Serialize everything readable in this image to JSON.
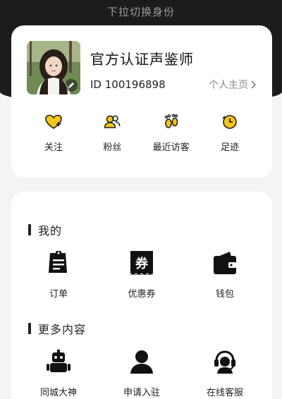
{
  "header": {
    "pull_hint": "下拉切换身份"
  },
  "profile": {
    "name": "官方认证声鉴师",
    "id_text": "ID 100196898",
    "homepage_label": "个人主页",
    "stats": [
      {
        "label": "关注",
        "icon": "heart-plus-icon"
      },
      {
        "label": "粉丝",
        "icon": "users-icon"
      },
      {
        "label": "最近访客",
        "icon": "footprints-icon"
      },
      {
        "label": "足迹",
        "icon": "clock-icon"
      }
    ]
  },
  "sections": {
    "mine": {
      "title": "我的",
      "items": [
        {
          "label": "订单",
          "icon": "order-icon"
        },
        {
          "label": "优惠券",
          "icon": "coupon-icon"
        },
        {
          "label": "钱包",
          "icon": "wallet-icon"
        }
      ]
    },
    "more": {
      "title": "更多内容",
      "items": [
        {
          "label": "同城大神",
          "icon": "robot-icon"
        },
        {
          "label": "申请入驻",
          "icon": "person-icon"
        },
        {
          "label": "在线客服",
          "icon": "headset-icon"
        }
      ]
    }
  },
  "colors": {
    "accent": "#f5c518",
    "dark": "#1c1c1c"
  }
}
